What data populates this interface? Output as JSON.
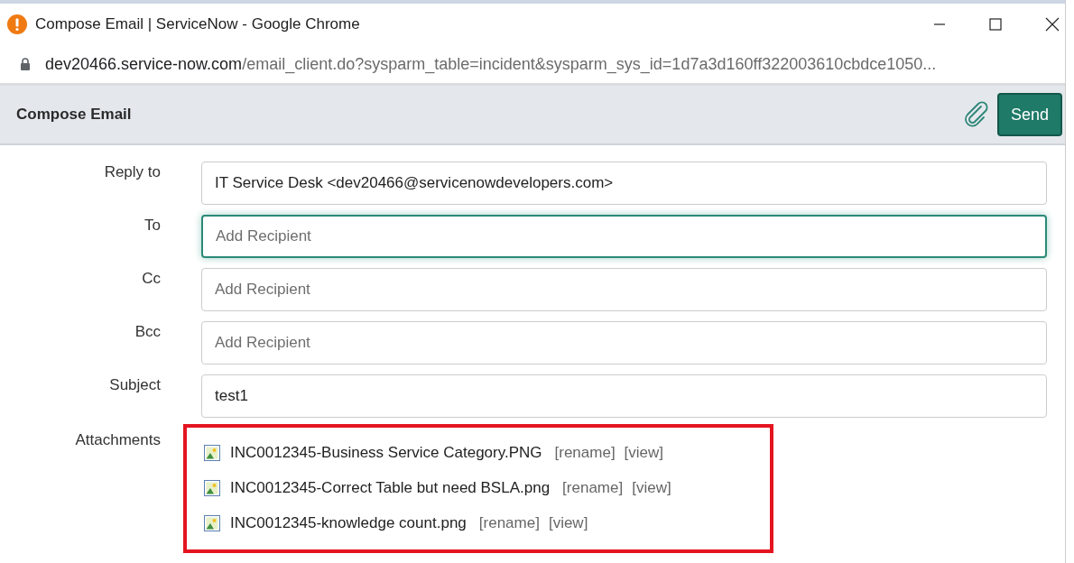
{
  "window": {
    "title": "Compose Email | ServiceNow - Google Chrome",
    "url_host": "dev20466.service-now.com",
    "url_path": "/email_client.do?sysparm_table=incident&sysparm_sys_id=1d7a3d160ff322003610cbdce1050..."
  },
  "header": {
    "title": "Compose Email",
    "send": "Send"
  },
  "fields": [
    {
      "label": "Reply to",
      "value": "IT Service Desk <dev20466@servicenowdevelopers.com>",
      "focused": false
    },
    {
      "label": "To",
      "placeholder": "Add Recipient",
      "focused": true
    },
    {
      "label": "Cc",
      "placeholder": "Add Recipient",
      "focused": false
    },
    {
      "label": "Bcc",
      "placeholder": "Add Recipient",
      "focused": false
    },
    {
      "label": "Subject",
      "value": "test1",
      "focused": false
    }
  ],
  "attachments": {
    "label": "Attachments",
    "highlighted": true,
    "items": [
      {
        "name": "INC0012345-Business Service Category.PNG",
        "rename": "[rename]",
        "view": "[view]"
      },
      {
        "name": "INC0012345-Correct Table but need BSLA.png",
        "rename": "[rename]",
        "view": "[view]"
      },
      {
        "name": "INC0012345-knowledge count.png",
        "rename": "[rename]",
        "view": "[view]"
      }
    ]
  }
}
